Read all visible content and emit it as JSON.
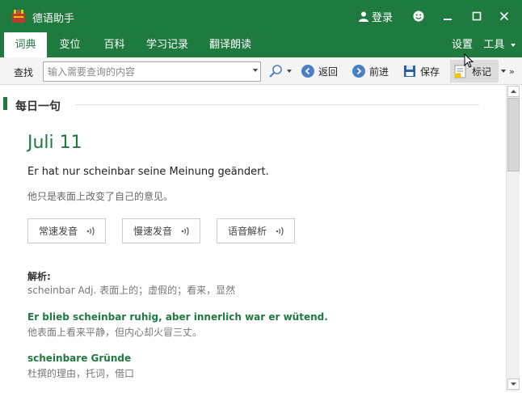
{
  "app": {
    "title": "德语助手",
    "login_label": "登录",
    "brand_color": "#1f7a3f"
  },
  "tabs": [
    {
      "label": "词典",
      "active": true
    },
    {
      "label": "变位",
      "active": false
    },
    {
      "label": "百科",
      "active": false
    },
    {
      "label": "学习记录",
      "active": false
    },
    {
      "label": "翻译朗读",
      "active": false
    }
  ],
  "menu": {
    "settings": "设置",
    "tools": "工具"
  },
  "toolbar": {
    "find_label": "查找",
    "search_placeholder": "输入需要查询的内容",
    "back": "返回",
    "forward": "前进",
    "save": "保存",
    "mark": "标记"
  },
  "daily": {
    "section_title": "每日一句",
    "date": "Juli 11",
    "sentence": "Er hat nur scheinbar seine Meinung geändert.",
    "translation": "他只是表面上改变了自己的意见。",
    "voice_buttons": [
      "常速发音",
      "慢速发音",
      "语音解析"
    ],
    "analysis_title": "解析:",
    "analysis_text": "scheinbar Adj. 表面上的；虚假的；看来，显然",
    "examples": [
      {
        "de": "Er blieb scheinbar ruhig, aber innerlich war er wütend.",
        "zh": "他表面上看来平静，但内心却火冒三丈。"
      },
      {
        "de": "scheinbare Gründe",
        "zh": "杜撰的理由，托词，借口"
      }
    ]
  }
}
